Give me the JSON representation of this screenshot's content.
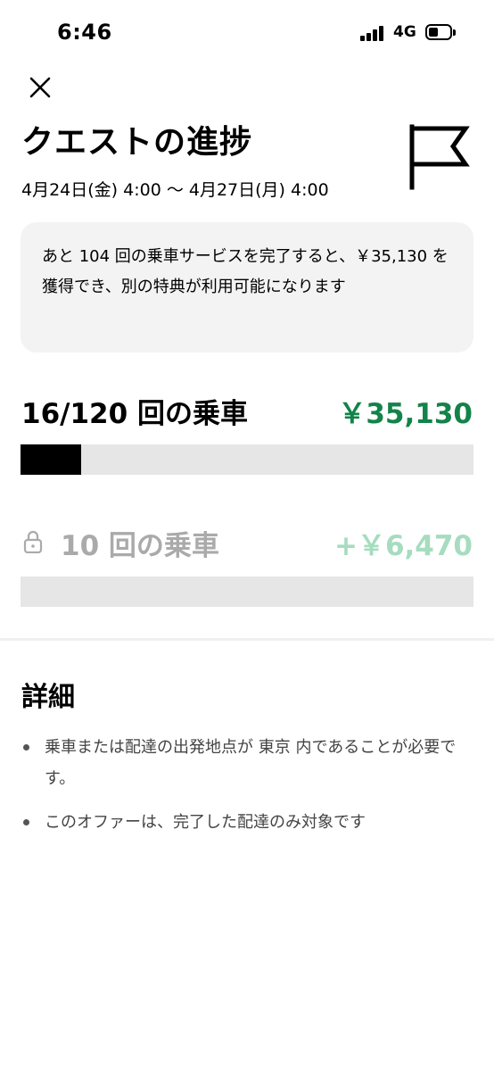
{
  "status_bar": {
    "time": "6:46",
    "network": "4G",
    "battery_level": 0.45
  },
  "header": {
    "close_icon": "close-icon",
    "title": "クエストの進捗",
    "flag_icon": "flag-icon",
    "date_range": "4月24日(金) 4:00 〜 4月27日(月) 4:00"
  },
  "info_card": {
    "message": "あと 104 回の乗車サービスを完了すると、￥35,130 を獲得でき、別の特典が利用可能になります"
  },
  "progress": {
    "current": {
      "label": "16/120 回の乗車",
      "amount": "￥35,130",
      "completed": 16,
      "target": 120,
      "amount_color": "#13834a"
    },
    "next": {
      "lock_icon": "lock-icon",
      "label": "10 回の乗車",
      "amount": "+￥6,470",
      "completed": 0,
      "target": 10,
      "amount_color": "#a6dcbf"
    }
  },
  "details": {
    "title": "詳細",
    "items": [
      "乗車または配達の出発地点が 東京 内であることが必要です。",
      "このオファーは、完了した配達のみ対象です"
    ]
  }
}
